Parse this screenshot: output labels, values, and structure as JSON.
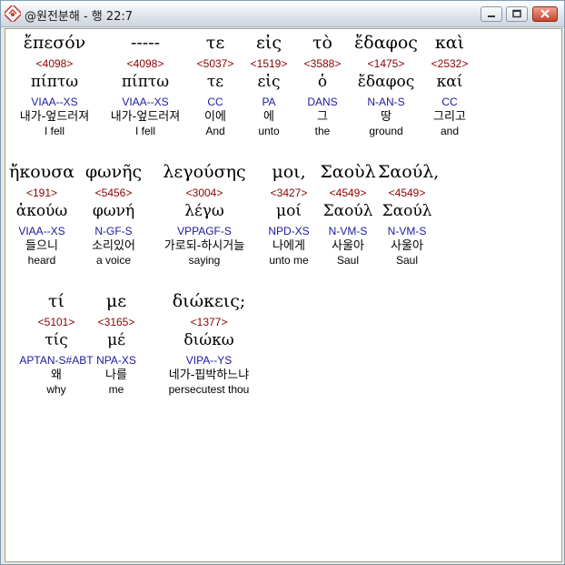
{
  "window": {
    "title": "@원전분해 - 행 22:7"
  },
  "rows": [
    [
      {
        "greek": "ἔπεσόν",
        "strong": "<4098>",
        "lemma": "πίπτω",
        "parse": "VIAA--XS",
        "korean": "내가-엎드러져",
        "english": "I fell"
      },
      {
        "greek": "-----",
        "strong": "<4098>",
        "lemma": "πίπτω",
        "parse": "VIAA--XS",
        "korean": "내가-엎드러져",
        "english": "I fell"
      },
      {
        "greek": "τε",
        "strong": "<5037>",
        "lemma": "τε",
        "parse": "CC",
        "korean": "이에",
        "english": "And"
      },
      {
        "greek": "εἰς",
        "strong": "<1519>",
        "lemma": "εἰς",
        "parse": "PA",
        "korean": "에",
        "english": "unto"
      },
      {
        "greek": "τὸ",
        "strong": "<3588>",
        "lemma": "ὁ",
        "parse": "DANS",
        "korean": "그",
        "english": "the"
      },
      {
        "greek": "ἔδαφος",
        "strong": "<1475>",
        "lemma": "ἔδαφος",
        "parse": "N-AN-S",
        "korean": "땅",
        "english": "ground"
      },
      {
        "greek": "καὶ",
        "strong": "<2532>",
        "lemma": "καί",
        "parse": "CC",
        "korean": "그리고",
        "english": "and"
      }
    ],
    [
      {
        "greek": "ἤκουσα",
        "strong": "<191>",
        "lemma": "ἀκούω",
        "parse": "VIAA--XS",
        "korean": "들으니",
        "english": "heard"
      },
      {
        "greek": "φωνῆς",
        "strong": "<5456>",
        "lemma": "φωνή",
        "parse": "N-GF-S",
        "korean": "소리있어",
        "english": "a voice"
      },
      {
        "greek": "λεγούσης",
        "strong": "<3004>",
        "lemma": "λέγω",
        "parse": "VPPAGF-S",
        "korean": "가로되-하시거늘",
        "english": "saying"
      },
      {
        "greek": "μοι,",
        "strong": "<3427>",
        "lemma": "μοί",
        "parse": "NPD-XS",
        "korean": "나에게",
        "english": "unto me"
      },
      {
        "greek": "Σαοὺλ",
        "strong": "<4549>",
        "lemma": "Σαούλ",
        "parse": "N-VM-S",
        "korean": "사울아",
        "english": "Saul"
      },
      {
        "greek": "Σαούλ,",
        "strong": "<4549>",
        "lemma": "Σαούλ",
        "parse": "N-VM-S",
        "korean": "사울아",
        "english": "Saul"
      }
    ],
    [
      {
        "greek": "τί",
        "strong": "<5101>",
        "lemma": "τίς",
        "parse": "APTAN-S#ABT",
        "korean": "왜",
        "english": "why"
      },
      {
        "greek": "με",
        "strong": "<3165>",
        "lemma": "μέ",
        "parse": "NPA-XS",
        "korean": "나를",
        "english": "me"
      },
      {
        "greek": "διώκεις;",
        "strong": "<1377>",
        "lemma": "διώκω",
        "parse": "VIPA--YS",
        "korean": "네가-핍박하느냐",
        "english": "persecutest thou"
      }
    ]
  ]
}
